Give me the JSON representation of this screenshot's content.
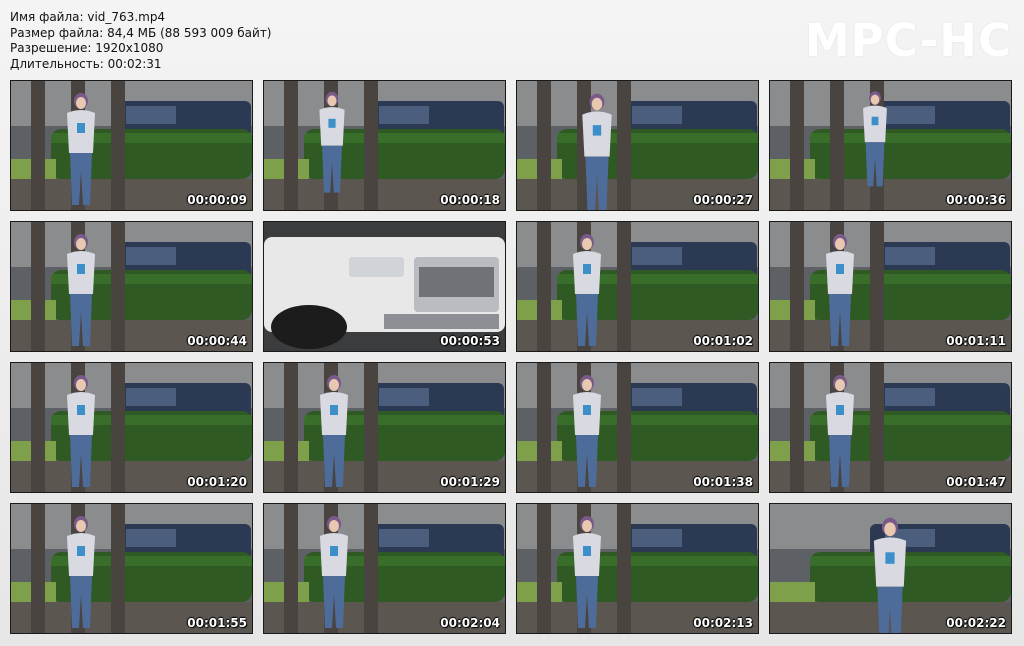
{
  "info": {
    "filename": "Имя файла: vid_763.mp4",
    "filesize": "Размер файла: 84,4 МБ (88 593 009 байт)",
    "resolution": "Разрешение: 1920x1080",
    "duration": "Длительность: 00:02:31"
  },
  "logo": "MPC-HC",
  "thumbnails": [
    {
      "timestamp": "00:00:09",
      "scene": "woman-walking-poles"
    },
    {
      "timestamp": "00:00:18",
      "scene": "woman-behind-poles"
    },
    {
      "timestamp": "00:00:27",
      "scene": "woman-walking-closer"
    },
    {
      "timestamp": "00:00:36",
      "scene": "woman-far-street"
    },
    {
      "timestamp": "00:00:44",
      "scene": "woman-phone"
    },
    {
      "timestamp": "00:00:53",
      "scene": "white-pickup-truck"
    },
    {
      "timestamp": "00:01:02",
      "scene": "woman-phone"
    },
    {
      "timestamp": "00:01:11",
      "scene": "woman-phone"
    },
    {
      "timestamp": "00:01:20",
      "scene": "woman-phone"
    },
    {
      "timestamp": "00:01:29",
      "scene": "woman-phone"
    },
    {
      "timestamp": "00:01:38",
      "scene": "woman-phone"
    },
    {
      "timestamp": "00:01:47",
      "scene": "woman-phone"
    },
    {
      "timestamp": "00:01:55",
      "scene": "woman-phone"
    },
    {
      "timestamp": "00:02:04",
      "scene": "woman-phone"
    },
    {
      "timestamp": "00:02:13",
      "scene": "woman-phone"
    },
    {
      "timestamp": "00:02:22",
      "scene": "woman-walking-close"
    }
  ]
}
